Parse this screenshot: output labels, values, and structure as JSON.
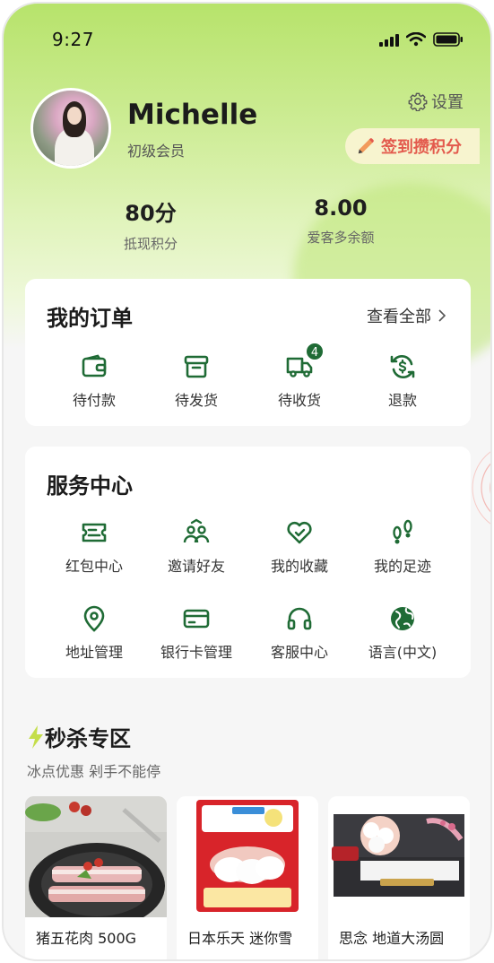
{
  "status_bar": {
    "time": "9:27"
  },
  "profile": {
    "name": "Michelle",
    "level": "初级会员",
    "settings_label": "设置",
    "checkin_label": "签到攒积分"
  },
  "stats": [
    {
      "value": "80分",
      "label": "抵现积分"
    },
    {
      "value": "8.00",
      "label": "爱客多余额"
    }
  ],
  "orders": {
    "title": "我的订单",
    "view_all": "查看全部",
    "items": [
      {
        "label": "待付款",
        "icon": "wallet-icon"
      },
      {
        "label": "待发货",
        "icon": "box-icon"
      },
      {
        "label": "待收货",
        "icon": "truck-icon",
        "badge": "4"
      },
      {
        "label": "退款",
        "icon": "refund-icon"
      }
    ]
  },
  "services": {
    "title": "服务中心",
    "items": [
      {
        "label": "红包中心",
        "icon": "coupon-icon"
      },
      {
        "label": "邀请好友",
        "icon": "invite-friends-icon"
      },
      {
        "label": "我的收藏",
        "icon": "favorite-heart-icon"
      },
      {
        "label": "我的足迹",
        "icon": "footprints-icon"
      },
      {
        "label": "地址管理",
        "icon": "location-pin-icon"
      },
      {
        "label": "银行卡管理",
        "icon": "bank-card-icon"
      },
      {
        "label": "客服中心",
        "icon": "headset-icon"
      },
      {
        "label": "语言(中文)",
        "icon": "globe-icon"
      }
    ]
  },
  "flash_sale": {
    "title": "秒杀专区",
    "subtitle": "冰点优惠 剁手不能停",
    "products": [
      {
        "name": "猪五花肉 500G"
      },
      {
        "name": "日本乐天 迷你雪"
      },
      {
        "name": "思念 地道大汤圆"
      }
    ]
  },
  "colors": {
    "accent": "#1f6b35",
    "header_green": "#b7e36b",
    "checkin_text": "#e35a4d"
  }
}
